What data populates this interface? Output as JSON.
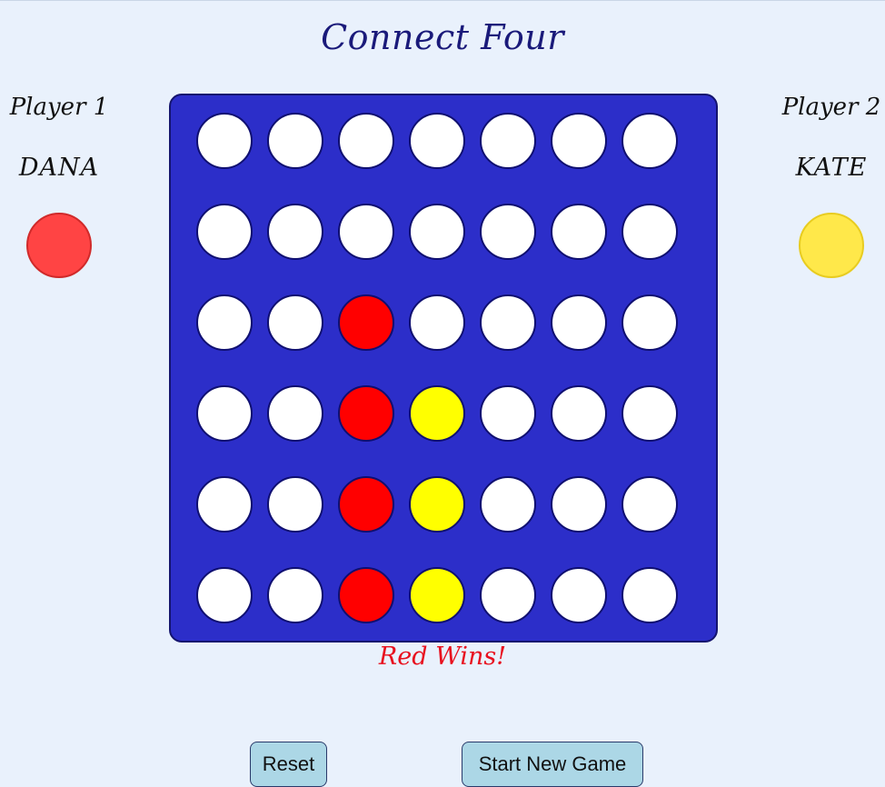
{
  "title": "Connect Four",
  "players": [
    {
      "label": "Player 1",
      "name": "DANA",
      "color": "red",
      "disc_hex": "#ff4444"
    },
    {
      "label": "Player 2",
      "name": "KATE",
      "color": "yellow",
      "disc_hex": "#ffe84a"
    }
  ],
  "board": {
    "rows": 6,
    "cols": 7,
    "cells": [
      [
        "empty",
        "empty",
        "empty",
        "empty",
        "empty",
        "empty",
        "empty"
      ],
      [
        "empty",
        "empty",
        "empty",
        "empty",
        "empty",
        "empty",
        "empty"
      ],
      [
        "empty",
        "empty",
        "red",
        "empty",
        "empty",
        "empty",
        "empty"
      ],
      [
        "empty",
        "empty",
        "red",
        "yellow",
        "empty",
        "empty",
        "empty"
      ],
      [
        "empty",
        "empty",
        "red",
        "yellow",
        "empty",
        "empty",
        "empty"
      ],
      [
        "empty",
        "empty",
        "red",
        "yellow",
        "empty",
        "empty",
        "empty"
      ]
    ]
  },
  "status": "Red Wins!",
  "buttons": {
    "reset": "Reset",
    "new_game": "Start New Game"
  },
  "colors": {
    "background": "#e9f1fc",
    "board": "#2c2ec9",
    "red": "#ff0000",
    "yellow": "#ffff00",
    "empty": "#ffffff",
    "status_text": "#e8101e",
    "title_text": "#1a1a7a",
    "button": "#acd7e6"
  }
}
